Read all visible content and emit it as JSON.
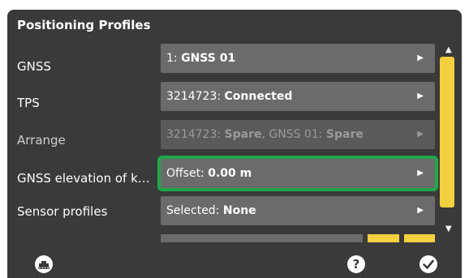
{
  "title": "Positioning Profiles",
  "rows": [
    {
      "label": "GNSS",
      "prefix": "1: ",
      "value": "GNSS 01",
      "suffix": "",
      "value2": ""
    },
    {
      "label": "TPS",
      "prefix": "3214723: ",
      "value": "Connected",
      "suffix": "",
      "value2": ""
    },
    {
      "label": "Arrange",
      "prefix": "3214723: ",
      "value": "Spare",
      "suffix": ", GNSS 01: ",
      "value2": "Spare"
    },
    {
      "label": "GNSS elevation of kn…",
      "prefix": "Offset: ",
      "value": "0.00 m",
      "suffix": "",
      "value2": ""
    },
    {
      "label": "Sensor profiles",
      "prefix": "Selected: ",
      "value": "None",
      "suffix": "",
      "value2": ""
    }
  ],
  "icons": {
    "row_arrow": "chevron-right-icon",
    "scroll_up": "scroll-up-icon",
    "scroll_down": "scroll-down-icon",
    "machine": "excavator-icon",
    "help": "help-icon",
    "confirm": "checkmark-icon"
  },
  "colors": {
    "panel": "#3a3a3a",
    "field": "#6b6b6b",
    "selection_outline": "#1fa84a",
    "scrollbar": "#f3d03f",
    "text": "#ffffff"
  }
}
